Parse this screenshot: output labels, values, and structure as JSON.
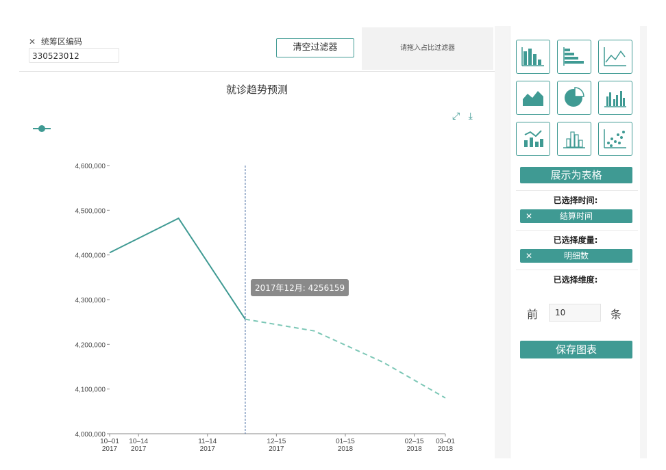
{
  "filter": {
    "close_glyph": "✕",
    "field_label": "统筹区编码",
    "field_value": "330523012",
    "clear_button": "清空过滤器",
    "drop_zone_text": "请拖入占比过滤器"
  },
  "chart": {
    "title": "就诊趋势预测",
    "tooltip": "2017年12月: 4256159",
    "toolbar_icons": [
      "expand-icon",
      "download-icon"
    ]
  },
  "chart_data": {
    "type": "line",
    "y_ticks": [
      "4,000,000",
      "4,100,000",
      "4,200,000",
      "4,300,000",
      "4,400,000",
      "4,500,000",
      "4,600,000"
    ],
    "ylim": [
      4000000,
      4600000
    ],
    "x_ticks": [
      {
        "date": "2017-10-01",
        "top": "10–01",
        "bottom": "2017"
      },
      {
        "date": "2017-10-14",
        "top": "10–14",
        "bottom": "2017"
      },
      {
        "date": "2017-11-14",
        "top": "11–14",
        "bottom": "2017"
      },
      {
        "date": "2017-12-15",
        "top": "12–15",
        "bottom": "2017"
      },
      {
        "date": "2018-01-15",
        "top": "01–15",
        "bottom": "2018"
      },
      {
        "date": "2018-02-15",
        "top": "02–15",
        "bottom": "2018"
      },
      {
        "date": "2018-03-01",
        "top": "03–01",
        "bottom": "2018"
      }
    ],
    "xlim": [
      "2017-10-01",
      "2018-03-01"
    ],
    "series": [
      {
        "style": "solid",
        "color": "#3f9a93",
        "points": [
          {
            "x": "2017-10-01",
            "y": 4405000
          },
          {
            "x": "2017-11-01",
            "y": 4482000
          },
          {
            "x": "2017-12-01",
            "y": 4256159
          }
        ]
      },
      {
        "style": "dashed",
        "color": "#7cc7b6",
        "points": [
          {
            "x": "2017-12-01",
            "y": 4256159
          },
          {
            "x": "2018-01-01",
            "y": 4230000
          },
          {
            "x": "2018-02-01",
            "y": 4160000
          },
          {
            "x": "2018-03-01",
            "y": 4080000
          }
        ]
      }
    ],
    "cursor_x": "2017-12-01"
  },
  "panel": {
    "chart_types": [
      "bar-chart-icon",
      "horizontal-bar-chart-icon",
      "line-chart-icon",
      "area-chart-icon",
      "pie-chart-icon",
      "grouped-bar-chart-icon",
      "line-bar-combo-icon",
      "histogram-icon",
      "scatter-chart-icon"
    ],
    "show_as_table": "展示为表格",
    "selected_time_label": "已选择时间:",
    "selected_time_value": "结算时间",
    "selected_measure_label": "已选择度量:",
    "selected_measure_value": "明细数",
    "selected_dimension_label": "已选择维度:",
    "chip_close": "✕",
    "top_prefix": "前",
    "top_value": "10",
    "top_suffix": "条",
    "save_chart": "保存图表"
  }
}
